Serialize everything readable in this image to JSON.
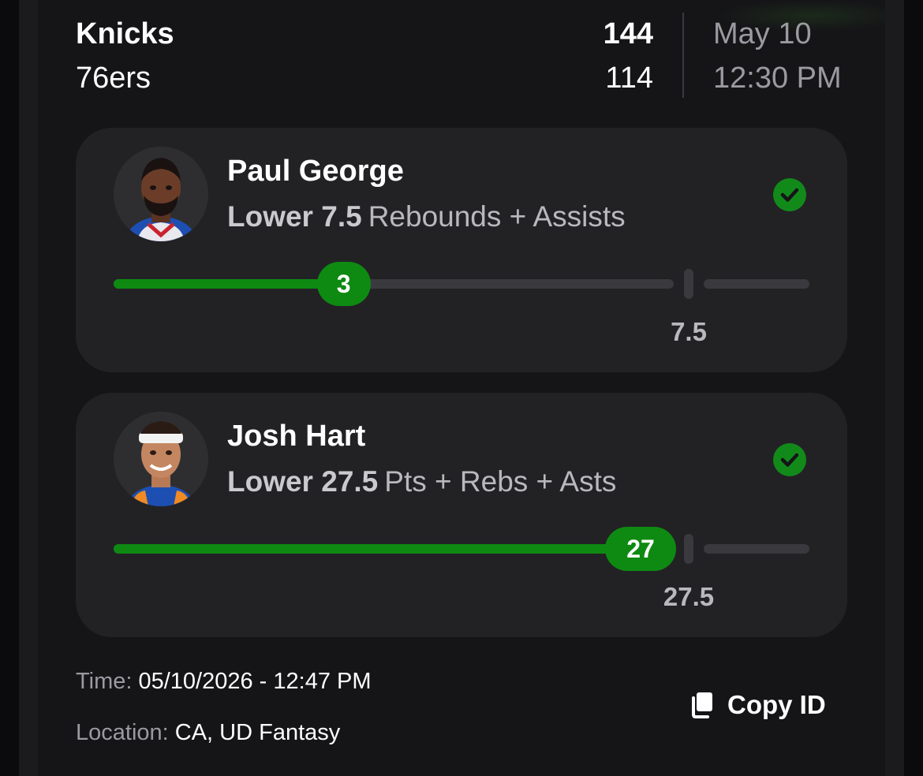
{
  "game": {
    "home_team": "Knicks",
    "away_team": "76ers",
    "home_score": "144",
    "away_score": "114",
    "date": "May 10",
    "time": "12:30 PM"
  },
  "picks": [
    {
      "player": "Paul George",
      "direction": "Lower 7.5",
      "stat": "Rebounds + Assists",
      "result_value": "3",
      "line_label": "7.5",
      "progress_fraction": 0.4,
      "status_icon": "check-circle-icon",
      "avatar_icon": "player-headshot"
    },
    {
      "player": "Josh Hart",
      "direction": "Lower 27.5",
      "stat": "Pts + Rebs + Asts",
      "result_value": "27",
      "line_label": "27.5",
      "progress_fraction": 0.982,
      "status_icon": "check-circle-icon",
      "avatar_icon": "player-headshot"
    }
  ],
  "footer": {
    "time_label": "Time: ",
    "time_value": "05/10/2026 - 12:47 PM",
    "location_label": "Location: ",
    "location_value": "CA, UD Fantasy",
    "copy_label": "Copy ID",
    "copy_icon": "copy-icon"
  },
  "colors": {
    "accent_green": "#0e8a12",
    "background": "#151518",
    "card": "#222225"
  }
}
